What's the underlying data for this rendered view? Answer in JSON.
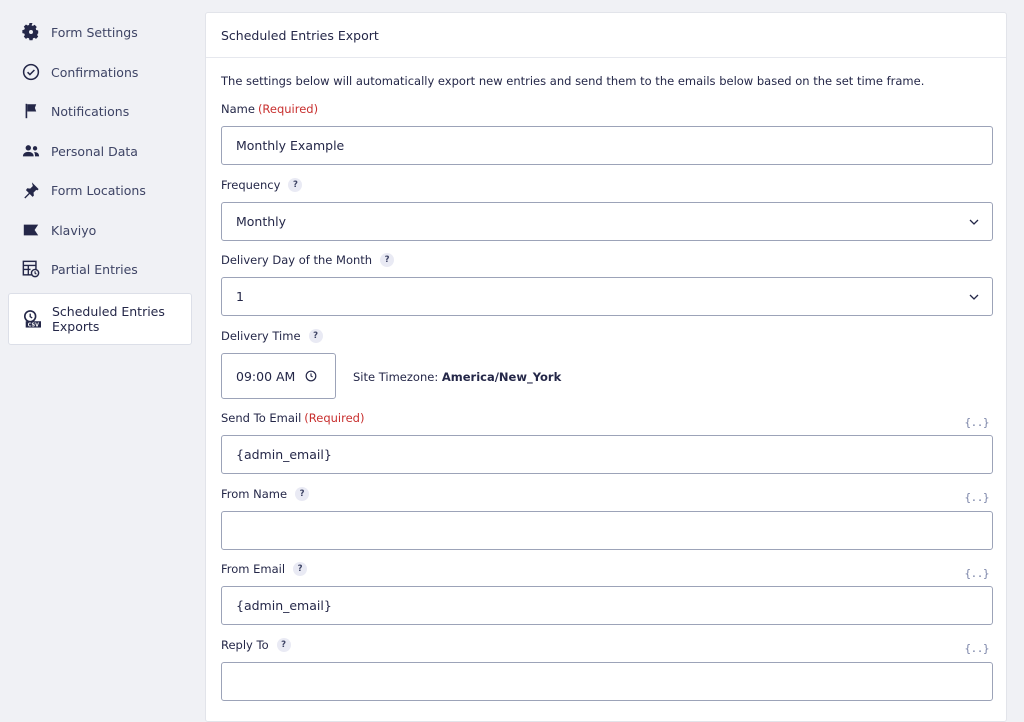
{
  "sidebar": {
    "items": [
      {
        "label": "Form Settings",
        "icon": "gear-icon"
      },
      {
        "label": "Confirmations",
        "icon": "check-circle-icon"
      },
      {
        "label": "Notifications",
        "icon": "flag-icon"
      },
      {
        "label": "Personal Data",
        "icon": "users-icon"
      },
      {
        "label": "Form Locations",
        "icon": "pin-icon"
      },
      {
        "label": "Klaviyo",
        "icon": "klaviyo-flag-icon"
      },
      {
        "label": "Partial Entries",
        "icon": "partial-table-icon"
      },
      {
        "label": "Scheduled Entries",
        "label2": "Exports",
        "icon": "csv-clock-icon",
        "active": true
      }
    ]
  },
  "panel": {
    "title": "Scheduled Entries Export",
    "description": "The settings below will automatically export new entries and send them to the emails below based on the set time frame.",
    "required_text": "(Required)",
    "help_glyph": "?",
    "merge_glyph": "{..}",
    "name": {
      "label": "Name",
      "value": "Monthly Example"
    },
    "frequency": {
      "label": "Frequency",
      "value": "Monthly"
    },
    "delivery_day": {
      "label": "Delivery Day of the Month",
      "value": "1"
    },
    "delivery_time": {
      "label": "Delivery Time",
      "value": "09:00 AM"
    },
    "timezone": {
      "label": "Site Timezone:",
      "value": "America/New_York"
    },
    "send_to": {
      "label": "Send To Email",
      "value": "{admin_email}"
    },
    "from_name": {
      "label": "From Name",
      "value": ""
    },
    "from_email": {
      "label": "From Email",
      "value": "{admin_email}"
    },
    "reply_to": {
      "label": "Reply To",
      "value": ""
    }
  },
  "colors": {
    "accent_text": "#242748",
    "required": "#c8302f",
    "border": "#9ca3b8",
    "background": "#f0f1f5"
  }
}
